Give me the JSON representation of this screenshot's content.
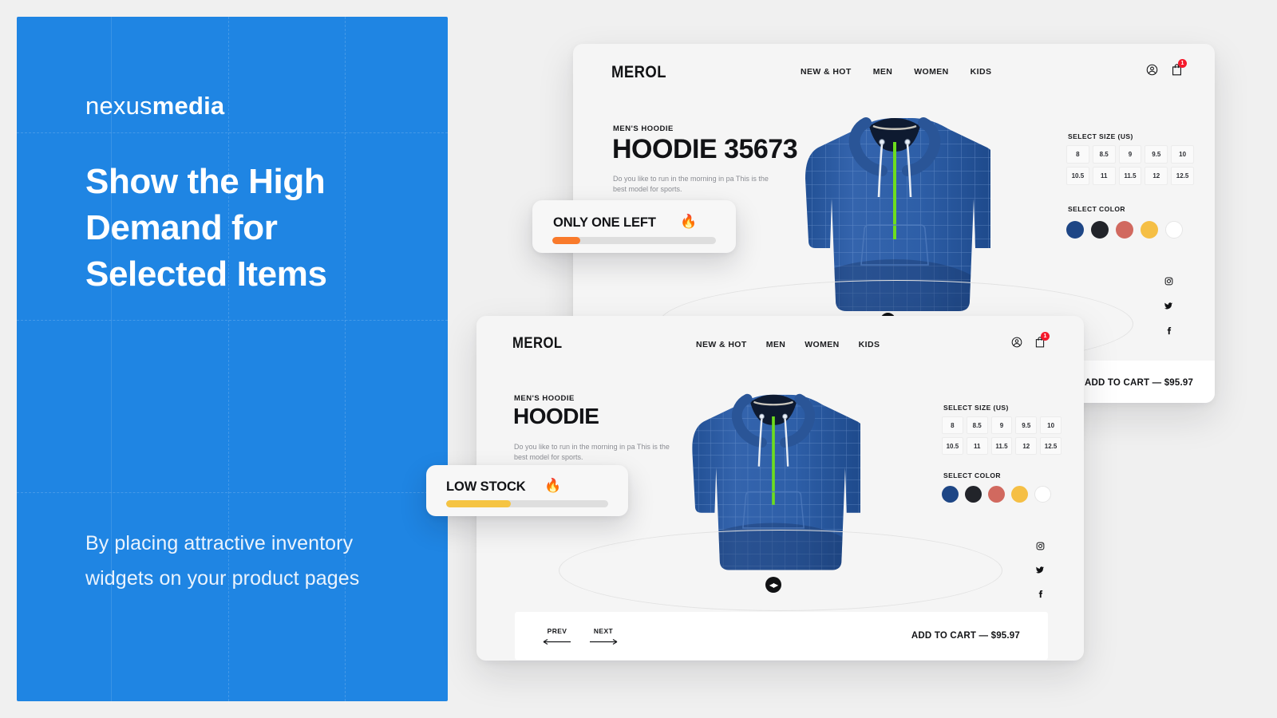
{
  "background_color": "#f0f0f0",
  "promo_panel": {
    "accent_color": "#1f85e3",
    "logo": {
      "light": "nexus",
      "bold": "media",
      "name": "nexusmedia"
    },
    "headline": "Show the High Demand for Selected Items",
    "subcopy": "By placing attractive inventory widgets on your product pages"
  },
  "product_cards": [
    {
      "id": "top",
      "brand": "MEROL",
      "nav": [
        "NEW & HOT",
        "MEN",
        "WOMEN",
        "KIDS"
      ],
      "account_icon": "user-circle-icon",
      "cart_icon": "shopping-bag-icon",
      "cart_count": "1",
      "eyebrow": "MEN'S HOODIE",
      "title": "HOODIE 35673",
      "description": "Do you like to run in the morning in pa This is the best model for sports.",
      "size_label": "SELECT SIZE (US)",
      "sizes": [
        "8",
        "8.5",
        "9",
        "9.5",
        "10",
        "10.5",
        "11",
        "11.5",
        "12",
        "12.5"
      ],
      "color_label": "SELECT COLOR",
      "colors": [
        "#1e4685",
        "#22242a",
        "#d1695f",
        "#f5bf45",
        "#ffffff"
      ],
      "social": [
        "instagram-icon",
        "twitter-icon",
        "facebook-icon"
      ],
      "add_to_cart": "ADD TO CART — $95.97",
      "price": "$95.97"
    },
    {
      "id": "bottom",
      "brand": "MEROL",
      "nav": [
        "NEW & HOT",
        "MEN",
        "WOMEN",
        "KIDS"
      ],
      "account_icon": "user-circle-icon",
      "cart_icon": "shopping-bag-icon",
      "cart_count": "1",
      "eyebrow": "MEN'S HOODIE",
      "title": "HOODIE",
      "description": "Do you like to run in the morning in pa This is the best model for sports.",
      "size_label": "SELECT SIZE (US)",
      "sizes": [
        "8",
        "8.5",
        "9",
        "9.5",
        "10",
        "10.5",
        "11",
        "11.5",
        "12",
        "12.5"
      ],
      "color_label": "SELECT COLOR",
      "colors": [
        "#1e4685",
        "#22242a",
        "#d1695f",
        "#f5bf45",
        "#ffffff"
      ],
      "social": [
        "instagram-icon",
        "twitter-icon",
        "facebook-icon"
      ],
      "prev_label": "PREV",
      "next_label": "NEXT",
      "add_to_cart": "ADD TO CART — $95.97",
      "price": "$95.97"
    }
  ],
  "stock_widgets": [
    {
      "id": "only-one-left",
      "title": "ONLY ONE LEFT",
      "emoji": "🔥",
      "fill_percent": 17,
      "fill_color": "#f97a2b",
      "track_color": "#dedede"
    },
    {
      "id": "low-stock",
      "title": "LOW STOCK",
      "emoji": "🔥",
      "fill_percent": 40,
      "fill_color": "#f5c443",
      "track_color": "#dedede"
    }
  ],
  "product_image": {
    "name": "blue-grid-hoodie",
    "body_color": "#2e5fa8",
    "zipper_color": "#6ddd1e"
  }
}
